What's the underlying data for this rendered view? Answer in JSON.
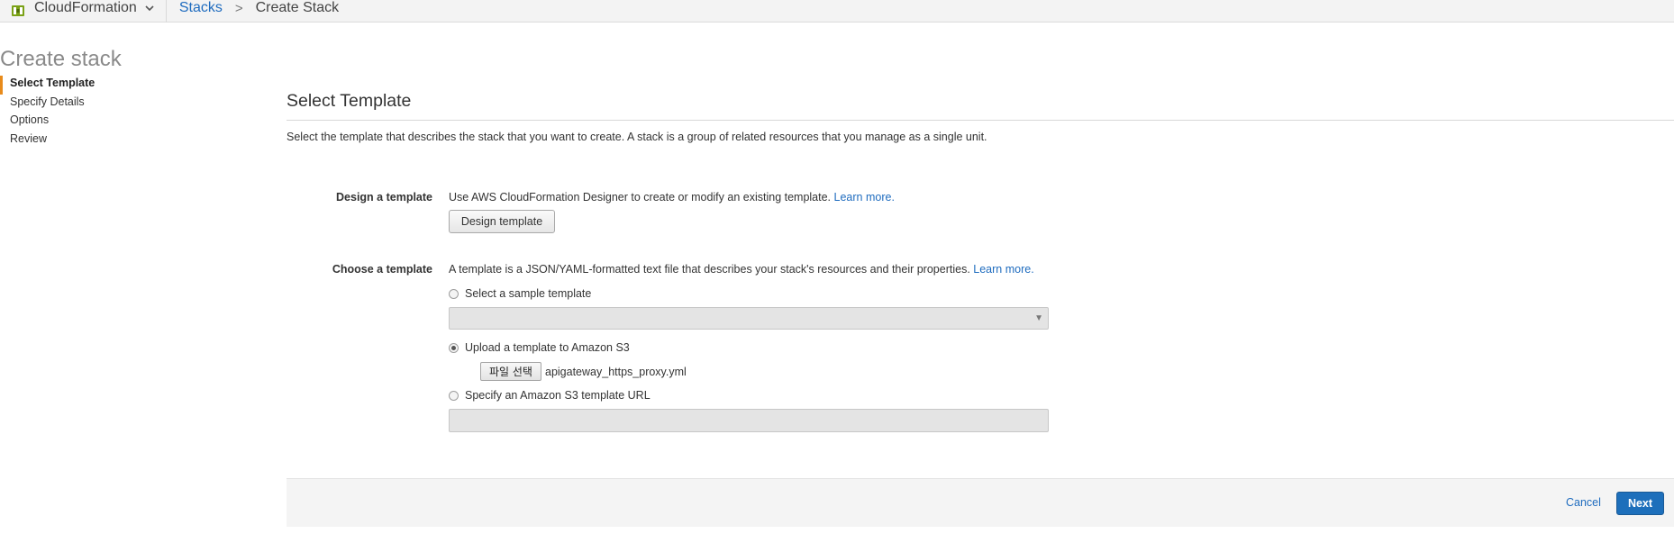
{
  "header": {
    "service_name": "CloudFormation",
    "breadcrumb": {
      "parent": "Stacks",
      "separator": ">",
      "current": "Create Stack"
    }
  },
  "page_title": "Create stack",
  "wizard_steps": [
    {
      "label": "Select Template",
      "active": true
    },
    {
      "label": "Specify Details",
      "active": false
    },
    {
      "label": "Options",
      "active": false
    },
    {
      "label": "Review",
      "active": false
    }
  ],
  "main": {
    "section_title": "Select Template",
    "intro": "Select the template that describes the stack that you want to create. A stack is a group of related resources that you manage as a single unit.",
    "design": {
      "label": "Design a template",
      "description": "Use AWS CloudFormation Designer to create or modify an existing template.",
      "learn_more": "Learn more.",
      "button_label": "Design template"
    },
    "choose": {
      "label": "Choose a template",
      "description": "A template is a JSON/YAML-formatted text file that describes your stack's resources and their properties.",
      "learn_more": "Learn more.",
      "options": [
        {
          "label": "Select a sample template",
          "checked": false
        },
        {
          "label": "Upload a template to Amazon S3",
          "checked": true
        },
        {
          "label": "Specify an Amazon S3 template URL",
          "checked": false
        }
      ],
      "sample_select_value": "",
      "file_button_label": "파일 선택",
      "file_name": "apigateway_https_proxy.yml",
      "url_value": ""
    }
  },
  "footer": {
    "cancel_label": "Cancel",
    "next_label": "Next"
  },
  "colors": {
    "accent_orange": "#e88b1b",
    "link_blue": "#1f6cbf",
    "primary_button": "#1d6fbb"
  }
}
